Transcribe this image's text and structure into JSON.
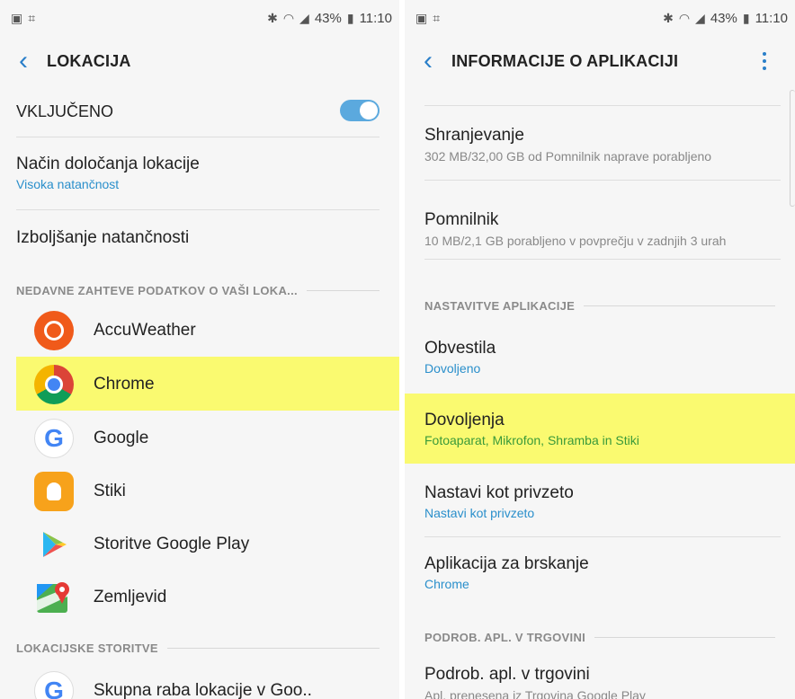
{
  "left": {
    "status": {
      "battery": "43%",
      "time": "11:10"
    },
    "title": "LOKACIJA",
    "toggle_label": "VKLJUČENO",
    "mode": {
      "title": "Način določanja lokacije",
      "value": "Visoka natančnost"
    },
    "accuracy": "Izboljšanje natančnosti",
    "recent_header": "NEDAVNE ZAHTEVE PODATKOV O VAŠI LOKA...",
    "apps": [
      {
        "label": "AccuWeather",
        "icon": "accuweather-icon"
      },
      {
        "label": "Chrome",
        "icon": "chrome-icon"
      },
      {
        "label": "Google",
        "icon": "google-icon"
      },
      {
        "label": "Stiki",
        "icon": "contacts-icon"
      },
      {
        "label": "Storitve Google Play",
        "icon": "play-services-icon"
      },
      {
        "label": "Zemljevid",
        "icon": "maps-icon"
      }
    ],
    "services_header": "LOKACIJSKE STORITVE",
    "services": [
      {
        "label": "Skupna raba lokacije v Goo..",
        "icon": "google-icon"
      }
    ]
  },
  "right": {
    "status": {
      "battery": "43%",
      "time": "11:10"
    },
    "title": "INFORMACIJE O APLIKACIJI",
    "storage": {
      "title": "Shranjevanje",
      "value": "302 MB/32,00 GB od Pomnilnik naprave porabljeno"
    },
    "memory": {
      "title": "Pomnilnik",
      "value": "10 MB/2,1 GB porabljeno v povprečju v zadnjih 3 urah"
    },
    "settings_header": "NASTAVITVE APLIKACIJE",
    "notifications": {
      "title": "Obvestila",
      "value": "Dovoljeno"
    },
    "permissions": {
      "title": "Dovoljenja",
      "value": "Fotoaparat, Mikrofon, Shramba in Stiki"
    },
    "default": {
      "title": "Nastavi kot privzeto",
      "value": "Nastavi kot privzeto"
    },
    "browser": {
      "title": "Aplikacija za brskanje",
      "value": "Chrome"
    },
    "store_header": "PODROB. APL. V TRGOVINI",
    "store": {
      "title": "Podrob. apl. v trgovini",
      "value": "Apl. prenesena iz Trgovina Google Play"
    }
  },
  "colors": {
    "accent": "#2a7fc9",
    "highlight": "#fafa70",
    "toggle_on": "#5ba9de"
  }
}
